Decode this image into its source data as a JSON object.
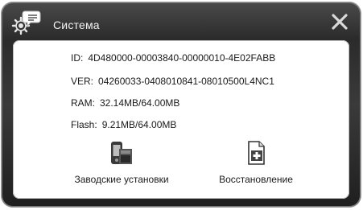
{
  "window": {
    "title": "Система"
  },
  "info": {
    "id": {
      "label": "ID:",
      "value": "4D480000-00003840-00000010-4E02FABB"
    },
    "ver": {
      "label": "VER:",
      "value": "04260033-0408010841-08010500L4NC1"
    },
    "ram": {
      "label": "RAM:",
      "value": "32.14MB/64.00MB"
    },
    "flash": {
      "label": "Flash:",
      "value": "9.21MB/64.00MB"
    }
  },
  "actions": {
    "factory_reset": {
      "label": "Заводские установки",
      "icon": "device-settings-icon"
    },
    "restore": {
      "label": "Восстановление",
      "icon": "restore-document-icon"
    }
  },
  "icons": {
    "app": "gear-chat-icon",
    "close": "close-icon"
  }
}
